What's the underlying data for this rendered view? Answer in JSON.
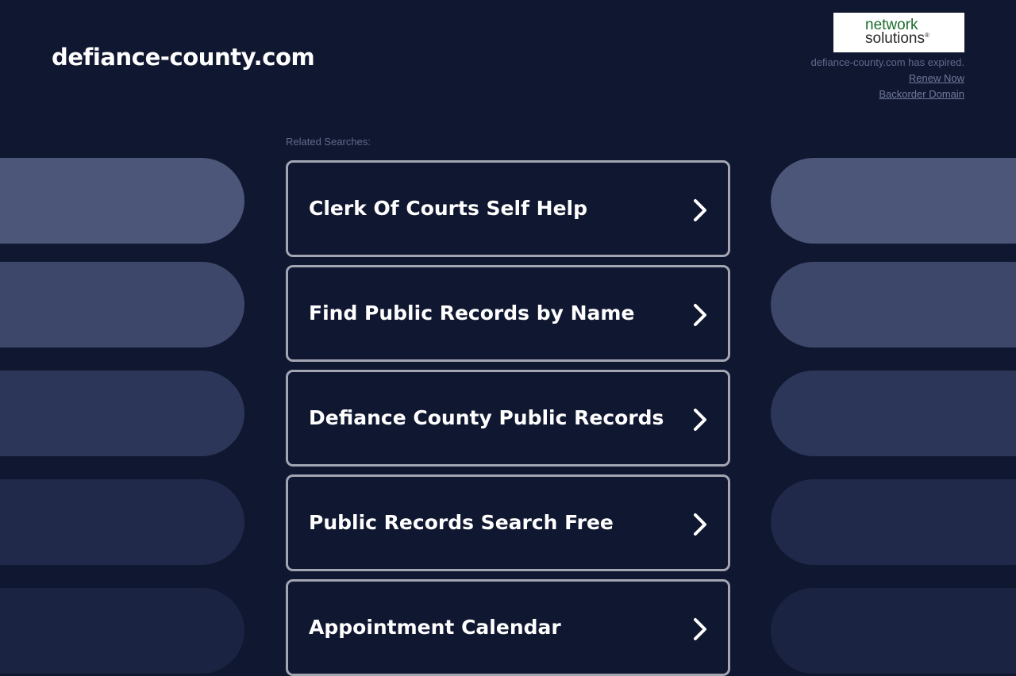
{
  "header": {
    "site_title": "defiance-county.com"
  },
  "registrar": {
    "logo_line1": "network",
    "logo_line2": "solutions",
    "logo_reg": "®",
    "expired_note": "defiance-county.com has expired.",
    "renew_label": "Renew Now",
    "backorder_label": "Backorder Domain"
  },
  "related": {
    "label": "Related Searches:",
    "items": [
      {
        "label": "Clerk Of Courts Self Help"
      },
      {
        "label": "Find Public Records by Name"
      },
      {
        "label": "Defiance County Public Records"
      },
      {
        "label": "Public Records Search Free"
      },
      {
        "label": "Appointment Calendar"
      }
    ]
  },
  "colors": {
    "background": "#101730",
    "card_border": "#a3a5b2",
    "card_text": "#ffffff",
    "muted_text": "#5f6a8d",
    "pill_row_1": "#4b5678",
    "pill_row_2": "#3d4769",
    "pill_row_3": "#2c3658",
    "pill_row_4": "#20294a",
    "pill_row_5": "#1b2343",
    "logo_green": "#1b6b2c"
  },
  "icons": {
    "card_arrow": "chevron-right-icon"
  }
}
